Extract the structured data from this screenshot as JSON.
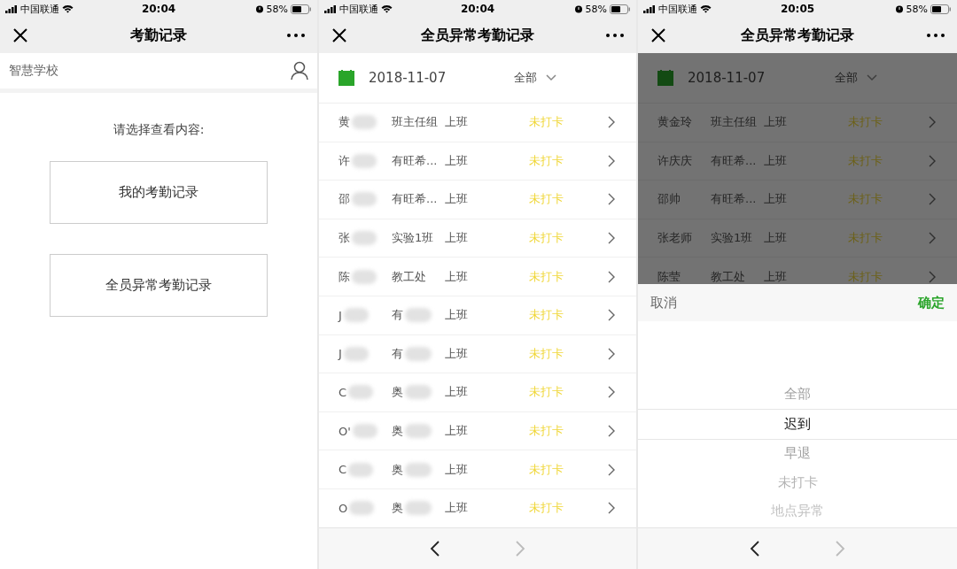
{
  "screens": [
    {
      "kind": "home",
      "status_bar": {
        "carrier": "中国联通",
        "time": "20:04",
        "battery": "58%"
      },
      "title": "考勤记录",
      "school": "智慧学校",
      "prompt": "请选择查看内容:",
      "options": [
        "我的考勤记录",
        "全员异常考勤记录"
      ]
    },
    {
      "kind": "list",
      "status_bar": {
        "carrier": "中国联通",
        "time": "20:04",
        "battery": "58%"
      },
      "title": "全员异常考勤记录",
      "date": "2018-11-07",
      "filter": "全部",
      "overlay": false,
      "rows": [
        {
          "name": "黄",
          "name_blurred": true,
          "dept": "班主任组",
          "dept_blurred": false,
          "shift": "上班",
          "status": "未打卡"
        },
        {
          "name": "许",
          "name_blurred": true,
          "dept": "有旺希...",
          "dept_blurred": false,
          "shift": "上班",
          "status": "未打卡"
        },
        {
          "name": "邵",
          "name_blurred": true,
          "dept": "有旺希...",
          "dept_blurred": false,
          "shift": "上班",
          "status": "未打卡"
        },
        {
          "name": "张",
          "name_blurred": true,
          "dept": "实验1班",
          "dept_blurred": false,
          "shift": "上班",
          "status": "未打卡"
        },
        {
          "name": "陈",
          "name_blurred": true,
          "dept": "教工处",
          "dept_blurred": false,
          "shift": "上班",
          "status": "未打卡"
        },
        {
          "name": "J",
          "name_blurred": true,
          "dept": "有",
          "dept_blurred": true,
          "shift": "上班",
          "status": "未打卡"
        },
        {
          "name": "J",
          "name_blurred": true,
          "dept": "有",
          "dept_blurred": true,
          "shift": "上班",
          "status": "未打卡"
        },
        {
          "name": "C",
          "name_blurred": true,
          "dept": "奥",
          "dept_blurred": true,
          "shift": "上班",
          "status": "未打卡"
        },
        {
          "name": "O'",
          "name_blurred": true,
          "dept": "奥",
          "dept_blurred": true,
          "shift": "上班",
          "status": "未打卡"
        },
        {
          "name": "C",
          "name_blurred": true,
          "dept": "奥",
          "dept_blurred": true,
          "shift": "上班",
          "status": "未打卡"
        },
        {
          "name": "O",
          "name_blurred": true,
          "dept": "奥",
          "dept_blurred": true,
          "shift": "上班",
          "status": "未打卡"
        }
      ],
      "nav": {
        "back_disabled": false,
        "forward_disabled": true
      }
    },
    {
      "kind": "list",
      "status_bar": {
        "carrier": "中国联通",
        "time": "20:05",
        "battery": "58%"
      },
      "title": "全员异常考勤记录",
      "date": "2018-11-07",
      "filter": "全部",
      "overlay": true,
      "rows": [
        {
          "name": "黄金玲",
          "name_blurred": false,
          "dept": "班主任组",
          "dept_blurred": false,
          "shift": "上班",
          "status": "未打卡"
        },
        {
          "name": "许庆庆",
          "name_blurred": false,
          "dept": "有旺希...",
          "dept_blurred": false,
          "shift": "上班",
          "status": "未打卡"
        },
        {
          "name": "邵帅",
          "name_blurred": false,
          "dept": "有旺希...",
          "dept_blurred": false,
          "shift": "上班",
          "status": "未打卡"
        },
        {
          "name": "张老师",
          "name_blurred": false,
          "dept": "实验1班",
          "dept_blurred": false,
          "shift": "上班",
          "status": "未打卡"
        },
        {
          "name": "陈莹",
          "name_blurred": false,
          "dept": "教工处",
          "dept_blurred": false,
          "shift": "上班",
          "status": "未打卡"
        }
      ],
      "picker": {
        "cancel": "取消",
        "confirm": "确定",
        "options": [
          {
            "label": "全部",
            "selected": false
          },
          {
            "label": "迟到",
            "selected": true
          },
          {
            "label": "早退",
            "selected": false
          },
          {
            "label": "未打卡",
            "selected": false
          },
          {
            "label": "地点异常",
            "selected": false
          }
        ]
      },
      "nav": {
        "back_disabled": false,
        "forward_disabled": true
      }
    }
  ]
}
